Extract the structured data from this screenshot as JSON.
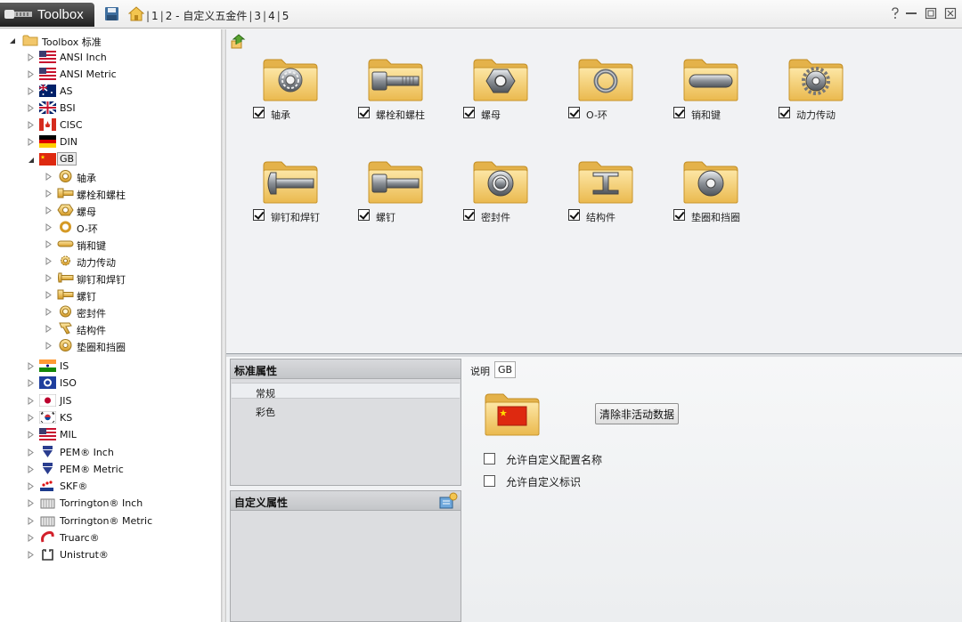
{
  "app": {
    "title": "Toolbox",
    "breadcrumb": [
      "1",
      "2 - 自定义五金件",
      "3",
      "4",
      "5"
    ]
  },
  "tree": {
    "root": "Toolbox 标准",
    "standards": [
      "ANSI Inch",
      "ANSI Metric",
      "AS",
      "BSI",
      "CISC",
      "DIN",
      "GB",
      "IS",
      "ISO",
      "JIS",
      "KS",
      "MIL",
      "PEM® Inch",
      "PEM® Metric",
      "SKF®",
      "Torrington® Inch",
      "Torrington® Metric",
      "Truarc®",
      "Unistrut®"
    ],
    "gb_children": [
      "轴承",
      "螺栓和螺柱",
      "螺母",
      "O-环",
      "销和键",
      "动力传动",
      "铆钉和焊钉",
      "螺钉",
      "密封件",
      "结构件",
      "垫圈和挡圈"
    ],
    "expanded": "GB"
  },
  "categories": [
    {
      "label": "轴承",
      "icon": "bearing-icon",
      "checked": true
    },
    {
      "label": "螺栓和螺柱",
      "icon": "bolt-icon",
      "checked": true
    },
    {
      "label": "螺母",
      "icon": "nut-icon",
      "checked": true
    },
    {
      "label": "O-环",
      "icon": "o-ring-icon",
      "checked": true
    },
    {
      "label": "销和键",
      "icon": "pin-key-icon",
      "checked": true
    },
    {
      "label": "动力传动",
      "icon": "gear-icon",
      "checked": true
    },
    {
      "label": "铆钉和焊钉",
      "icon": "rivet-icon",
      "checked": true
    },
    {
      "label": "螺钉",
      "icon": "screw-icon",
      "checked": true
    },
    {
      "label": "密封件",
      "icon": "seal-icon",
      "checked": true
    },
    {
      "label": "结构件",
      "icon": "structural-beam-icon",
      "checked": true
    },
    {
      "label": "垫圈和挡圈",
      "icon": "washer-icon",
      "checked": true
    }
  ],
  "standard_props": {
    "title": "标准属性",
    "items": [
      "常规",
      "彩色"
    ],
    "selected": "常规"
  },
  "custom_props": {
    "title": "自定义属性"
  },
  "general": {
    "desc_label": "说明",
    "desc_value": "GB",
    "clear_button": "清除非活动数据",
    "options": [
      {
        "label": "允许自定义配置名称",
        "checked": false
      },
      {
        "label": "允许自定义标识",
        "checked": false
      }
    ]
  },
  "colors": {
    "folder": "#f6d27a",
    "folder_dark": "#e0ac3c",
    "title_bar_tab": "#2a2a2a",
    "flag_red": "#de2910"
  }
}
